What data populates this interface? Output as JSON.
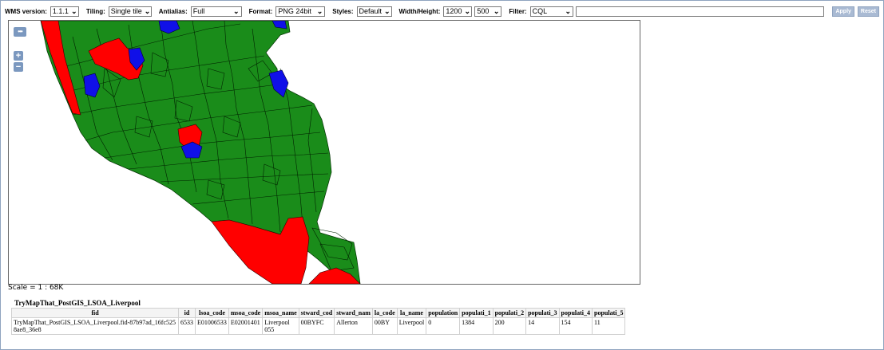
{
  "toolbar": {
    "wms_version_label": "WMS version:",
    "wms_version_value": "1.1.1",
    "tiling_label": "Tiling:",
    "tiling_value": "Single tile",
    "antialias_label": "Antialias:",
    "antialias_value": "Full",
    "format_label": "Format:",
    "format_value": "PNG 24bit",
    "styles_label": "Styles:",
    "styles_value": "Default",
    "width_height_label": "Width/Height:",
    "width_value": "1200",
    "height_value": "500",
    "filter_label": "Filter:",
    "filter_type_value": "CQL",
    "filter_text_value": "",
    "apply_label": "Apply",
    "reset_label": "Reset"
  },
  "map": {
    "zoom_in_symbol": "+",
    "zoom_out_symbol": "−",
    "toggle_symbol": "•••",
    "colors": {
      "green": "#1a8c1a",
      "red": "#ff0000",
      "blue": "#1010e8",
      "border": "#003000"
    }
  },
  "scale_text": "Scale = 1 : 68K",
  "layer_title": "TryMapThat_PostGIS_LSOA_Liverpool",
  "table": {
    "headers": [
      "fid",
      "id",
      "lsoa_code",
      "msoa_code",
      "msoa_name",
      "stward_cod",
      "stward_nam",
      "la_code",
      "la_name",
      "population",
      "populati_1",
      "populati_2",
      "populati_3",
      "populati_4",
      "populati_5"
    ],
    "rows": [
      [
        "TryMapThat_PostGIS_LSOA_Liverpool.fid-87b97ad_16fc5258ae8_36e8",
        "6533",
        "E01006533",
        "E02001401",
        "Liverpool 055",
        "00BYFC",
        "Allerton",
        "00BY",
        "Liverpool",
        "0",
        "1384",
        "200",
        "14",
        "154",
        "11"
      ]
    ]
  }
}
